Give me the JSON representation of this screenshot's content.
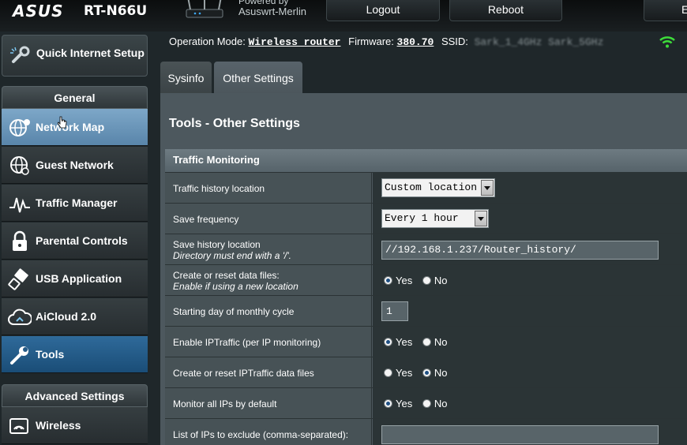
{
  "header": {
    "logo": "ASUS",
    "model": "RT-N66U",
    "powered_by": "Powered by",
    "firmware_brand": "Asuswrt-Merlin",
    "logout": "Logout",
    "reboot": "Reboot",
    "language": "E"
  },
  "sidebar": {
    "quick_setup": "Quick Internet Setup",
    "general_header": "General",
    "general_items": [
      {
        "label": "Network Map",
        "icon": "globe-icon"
      },
      {
        "label": "Guest Network",
        "icon": "guest-network-icon"
      },
      {
        "label": "Traffic Manager",
        "icon": "traffic-manager-icon"
      },
      {
        "label": "Parental Controls",
        "icon": "parental-lock-icon"
      },
      {
        "label": "USB Application",
        "icon": "usb-icon"
      },
      {
        "label": "AiCloud 2.0",
        "icon": "cloud-icon"
      },
      {
        "label": "Tools",
        "icon": "wrench-icon"
      }
    ],
    "advanced_header": "Advanced Settings",
    "advanced_items": [
      {
        "label": "Wireless",
        "icon": "wireless-icon"
      }
    ]
  },
  "status": {
    "op_mode_label": "Operation Mode:",
    "op_mode_value": "Wireless router",
    "firmware_label": "Firmware:",
    "firmware_value": "380.70",
    "ssid_label": "SSID:",
    "ssid_value": "Sark_1_4GHz Sark_5GHz"
  },
  "tabs": [
    {
      "label": "Sysinfo"
    },
    {
      "label": "Other Settings"
    }
  ],
  "page": {
    "title": "Tools - Other Settings",
    "section_title": "Traffic Monitoring"
  },
  "rows": [
    {
      "label": "Traffic history location",
      "value": "Custom location"
    },
    {
      "label": "Save frequency",
      "value": "Every 1 hour"
    },
    {
      "label": "Save history location",
      "sublabel": "Directory must end with a '/'.",
      "value": "//192.168.1.237/Router_history/"
    },
    {
      "label": "Create or reset data files:",
      "sublabel": "Enable if using a new location",
      "yes": "Yes",
      "no": "No",
      "selected": "Yes"
    },
    {
      "label": "Starting day of monthly cycle",
      "value": "1"
    },
    {
      "label": "Enable IPTraffic (per IP monitoring)",
      "yes": "Yes",
      "no": "No",
      "selected": "Yes"
    },
    {
      "label": "Create or reset IPTraffic data files",
      "yes": "Yes",
      "no": "No",
      "selected": "No"
    },
    {
      "label": "Monitor all IPs by default",
      "yes": "Yes",
      "no": "No",
      "selected": "Yes"
    },
    {
      "label": "List of IPs to exclude (comma-separated):",
      "value": ""
    }
  ]
}
